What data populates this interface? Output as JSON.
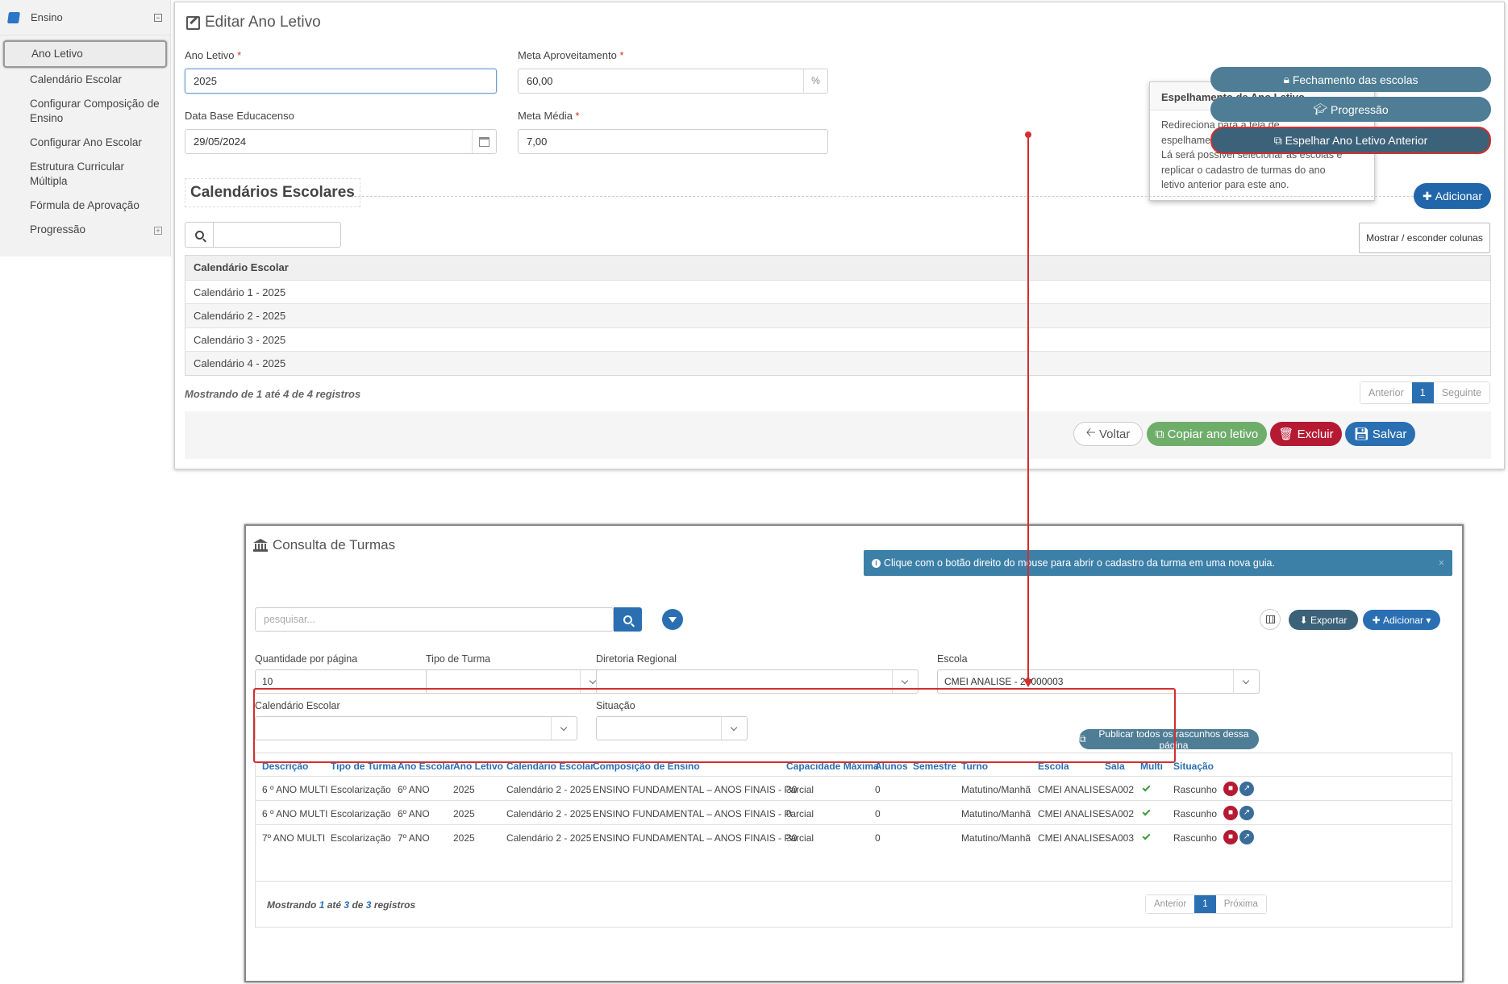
{
  "sidebar": {
    "header": "Ensino",
    "items": [
      {
        "label": "Ano Letivo"
      },
      {
        "label": "Calendário Escolar"
      },
      {
        "label": "Configurar Composição de Ensino"
      },
      {
        "label": "Configurar Ano Escolar"
      },
      {
        "label": "Estrutura Curricular Múltipla"
      },
      {
        "label": "Fórmula de Aprovação"
      },
      {
        "label": "Progressão"
      }
    ]
  },
  "edit": {
    "title": "Editar Ano Letivo",
    "ano_letivo_label": "Ano Letivo",
    "ano_letivo_value": "2025",
    "meta_aprov_label": "Meta Aproveitamento",
    "meta_aprov_value": "60,00",
    "meta_aprov_suffix": "%",
    "data_base_label": "Data Base Educacenso",
    "data_base_value": "29/05/2024",
    "meta_media_label": "Meta Média",
    "meta_media_value": "7,00",
    "required_mark": "*"
  },
  "actions": {
    "fechamento": "Fechamento das escolas",
    "progressao": "Progressão",
    "espelhar": "Espelhar Ano Letivo Anterior",
    "adicionar": "Adicionar",
    "mostrar_colunas": "Mostrar / esconder colunas"
  },
  "callout": {
    "title": "Espelhamento de Ano Letivo",
    "line1": "Redireciona para a tela de",
    "line2": "espelhamento do ano letivo.",
    "line3": "Lá será possível selecionar as escolas e",
    "line4": "replicar o cadastro de turmas do ano",
    "line5": "letivo anterior para este ano."
  },
  "calendarios": {
    "title": "Calendários Escolares",
    "header": "Calendário Escolar",
    "rows": [
      "Calendário 1 - 2025",
      "Calendário 2 - 2025",
      "Calendário 3 - 2025",
      "Calendário 4 - 2025"
    ],
    "info": "Mostrando de 1 até 4 de 4 registros",
    "pager_prev": "Anterior",
    "pager_page": "1",
    "pager_next": "Seguinte"
  },
  "footer_buttons": {
    "voltar": "Voltar",
    "copiar": "Copiar ano letivo",
    "excluir": "Excluir",
    "salvar": "Salvar"
  },
  "turmas": {
    "title": "Consulta de Turmas",
    "alert": "Clique com o botão direito do mouse para abrir o cadastro da turma em uma nova guia.",
    "search_placeholder": "pesquisar...",
    "exportar": "Exportar",
    "adicionar": "Adicionar",
    "qtd_label": "Quantidade por página",
    "qtd_value": "10",
    "tipo_label": "Tipo de Turma",
    "diretoria_label": "Diretoria Regional",
    "escola_label": "Escola",
    "escola_value": "CMEI ANALISE - 25000003",
    "calendario_label": "Calendário Escolar",
    "situacao_label": "Situação",
    "publicar": "Publicar todos os rascunhos dessa página",
    "columns": [
      "Descrição",
      "Tipo de Turma",
      "Ano Escolar",
      "Ano Letivo",
      "Calendário Escolar",
      "Composição de Ensino",
      "Capacidade Máxima",
      "Alunos",
      "Semestre",
      "Turno",
      "Escola",
      "Sala",
      "Multi",
      "Situação"
    ],
    "rows": [
      [
        "6 º ANO MULTI",
        "Escolarização",
        "6º ANO",
        "2025",
        "Calendário 2 - 2025",
        "ENSINO FUNDAMENTAL – ANOS FINAIS - Parcial",
        "30",
        "0",
        "",
        "Matutino/Manhã",
        "CMEI ANALISE",
        "SA002",
        "",
        "Rascunho"
      ],
      [
        "6 º ANO MULTI",
        "Escolarização",
        "6º ANO",
        "2025",
        "Calendário 2 - 2025",
        "ENSINO FUNDAMENTAL – ANOS FINAIS - Parcial",
        "0",
        "0",
        "",
        "Matutino/Manhã",
        "CMEI ANALISE",
        "SA002",
        "",
        "Rascunho"
      ],
      [
        "7º ANO MULTI",
        "Escolarização",
        "7º ANO",
        "2025",
        "Calendário 2 - 2025",
        "ENSINO FUNDAMENTAL – ANOS FINAIS - Parcial",
        "30",
        "0",
        "",
        "Matutino/Manhã",
        "CMEI ANALISE",
        "SA003",
        "",
        "Rascunho"
      ]
    ],
    "info_prefix": "Mostrando",
    "info_a": "1",
    "info_ate": "até",
    "info_b": "3",
    "info_de": "de",
    "info_c": "3",
    "info_suffix": "registros",
    "pager_prev": "Anterior",
    "pager_page": "1",
    "pager_next": "Próxima"
  },
  "colors": {
    "accent": "#2a6fb2",
    "highlight": "#d32f2f"
  }
}
